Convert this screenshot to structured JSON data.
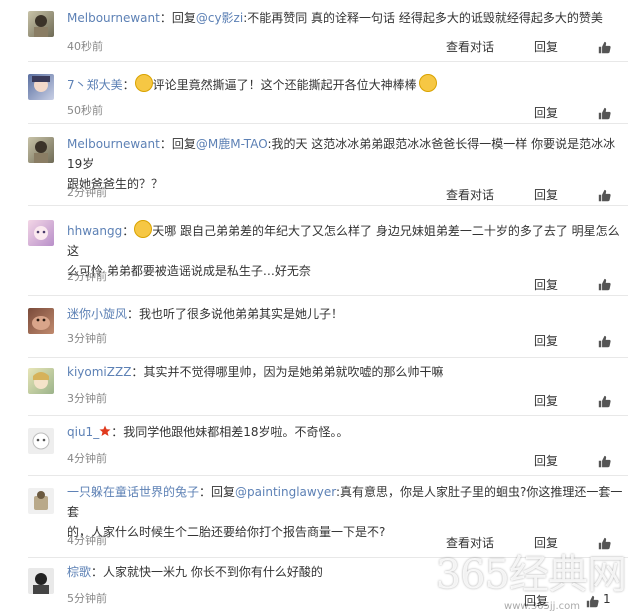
{
  "comments": [
    {
      "user": "Melbournewant",
      "sep": "：",
      "reply_prefix": "回复",
      "mention": "@cy影zi",
      "text": ":不能再赞同 真的诠释一句话 经得起多大的诋毁就经得起多大的赞美",
      "time": "40秒前",
      "view_dialog": "查看对话",
      "reply": "回复"
    },
    {
      "user": "7丶郑大美",
      "sep": "：",
      "text": "评论里竟然撕逼了！这个还能撕起开各位大神棒棒",
      "time": "50秒前",
      "reply": "回复"
    },
    {
      "user": "Melbournewant",
      "sep": "：",
      "reply_prefix": "回复",
      "mention": "@M鹿M-TAO",
      "text_line1": ":我的天 这范冰冰弟弟跟范冰冰爸爸长得一模一样 你要说是范冰冰19岁",
      "text_line2": "跟她爸爸生的？？",
      "time": "2分钟前",
      "view_dialog": "查看对话",
      "reply": "回复"
    },
    {
      "user": "hhwangg",
      "sep": "：",
      "text_line1": "天哪 跟自己弟弟差的年纪大了又怎么样了 身边兄妹姐弟差一二十岁的多了去了 明星怎么这",
      "text_line2": "么可怜 弟弟都要被造谣说成是私生子…好无奈",
      "time": "2分钟前",
      "reply": "回复"
    },
    {
      "user": "迷你小旋风",
      "sep": "：",
      "text": "我也听了很多说他弟弟其实是她儿子！",
      "time": "3分钟前",
      "reply": "回复"
    },
    {
      "user": "kiyomiZZZ",
      "sep": "：",
      "text": "其实并不觉得哪里帅，因为是她弟弟就吹嘘的那么帅干嘛",
      "time": "3分钟前",
      "reply": "回复"
    },
    {
      "user": "qiu1_",
      "sep": "：",
      "text": "我同学他跟他妹都相差18岁啦。不奇怪。。",
      "time": "4分钟前",
      "reply": "回复"
    },
    {
      "user": "一只躲在童话世界的兔子",
      "sep": "：",
      "reply_prefix": "回复",
      "mention": "@paintinglawyer",
      "text_line1": ":真有意思，你是人家肚子里的蛔虫?你这推理还一套一套",
      "text_line2": "的，人家什么时候生个二胎还要给你打个报告商量一下是不?",
      "time": "4分钟前",
      "view_dialog": "查看对话",
      "reply": "回复"
    },
    {
      "user": "棕歌",
      "sep": "：",
      "text": "人家就快一米九 你长不到你有什么好酸的",
      "time": "5分钟前",
      "reply": "回复",
      "like_count": "1"
    }
  ],
  "watermark": "365经典网",
  "watermark_small": "www.365jj.com",
  "colors": {
    "link": "#5d81b5",
    "text": "#333333",
    "time": "#888888",
    "divider": "#e8e8e8"
  },
  "icons": {
    "like": "thumbs-up-icon",
    "emoji": "smiley-icon",
    "crown": "star-badge-icon"
  }
}
